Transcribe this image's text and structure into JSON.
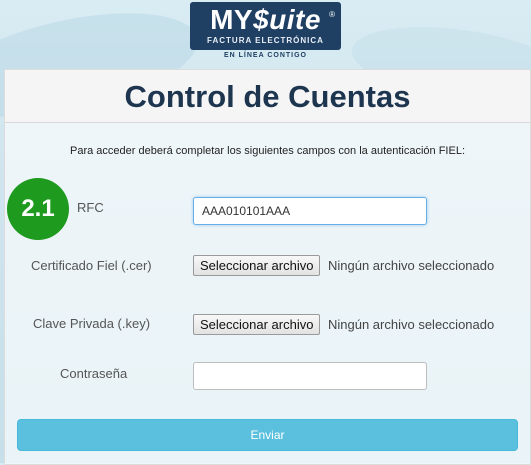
{
  "logo": {
    "brand_my": "MY",
    "brand_suite": "$uite",
    "registered": "®",
    "subtitle": "FACTURA ELECTRÓNICA",
    "tagline": "EN LÍNEA CONTIGO"
  },
  "page": {
    "title": "Control de Cuentas",
    "instruction": "Para acceder deberá completar los siguientes campos con la autenticación FIEL:",
    "step_badge": "2.1"
  },
  "form": {
    "rfc": {
      "label": "RFC",
      "value": "AAA010101AAA"
    },
    "certificate": {
      "label": "Certificado Fiel (.cer)",
      "button": "Seleccionar archivo",
      "status": "Ningún archivo seleccionado"
    },
    "private_key": {
      "label": "Clave Privada (.key)",
      "button": "Seleccionar archivo",
      "status": "Ningún archivo seleccionado"
    },
    "password": {
      "label": "Contraseña",
      "value": ""
    },
    "submit": "Enviar"
  },
  "colors": {
    "brand_navy": "#1f3f63",
    "title_text": "#1e3550",
    "step_badge": "#1e9a1e",
    "submit_button": "#5bc0de"
  }
}
